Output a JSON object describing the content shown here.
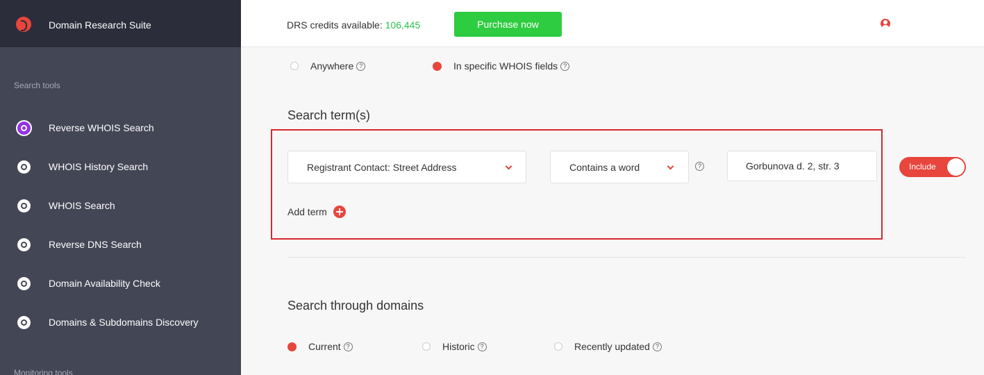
{
  "sidebar": {
    "brand": "Domain Research Suite",
    "search_tools_label": "Search tools",
    "items": [
      {
        "label": "Reverse WHOIS Search",
        "icon": "reverse-whois-icon"
      },
      {
        "label": "WHOIS History Search",
        "icon": "history-icon"
      },
      {
        "label": "WHOIS Search",
        "icon": "user-circle-icon"
      },
      {
        "label": "Reverse DNS Search",
        "icon": "globe-icon"
      },
      {
        "label": "Domain Availability Check",
        "icon": "availability-icon"
      },
      {
        "label": "Domains & Subdomains Discovery",
        "icon": "discovery-icon"
      }
    ],
    "monitoring_tools_label": "Monitoring tools"
  },
  "topbar": {
    "credits_label": "DRS credits available:",
    "credits_value": "106,445",
    "purchase_label": "Purchase now"
  },
  "search_scope": {
    "anywhere": "Anywhere",
    "specific": "In specific WHOIS fields",
    "selected": "specific"
  },
  "search_terms": {
    "heading": "Search term(s)",
    "field_select": "Registrant Contact: Street Address",
    "match_select": "Contains a word",
    "term_value": "Gorbunova d. 2, str. 3",
    "toggle_label": "Include",
    "add_term_label": "Add term"
  },
  "domains": {
    "heading": "Search through domains",
    "options": [
      "Current",
      "Historic",
      "Recently updated"
    ],
    "selected": "Current"
  },
  "colors": {
    "accent": "#e8453c",
    "green": "#2ecc40",
    "sidebar": "#434655",
    "sidebar_header": "#2b2d3a",
    "active_icon": "#9333ea",
    "highlight": "#d7262c"
  }
}
